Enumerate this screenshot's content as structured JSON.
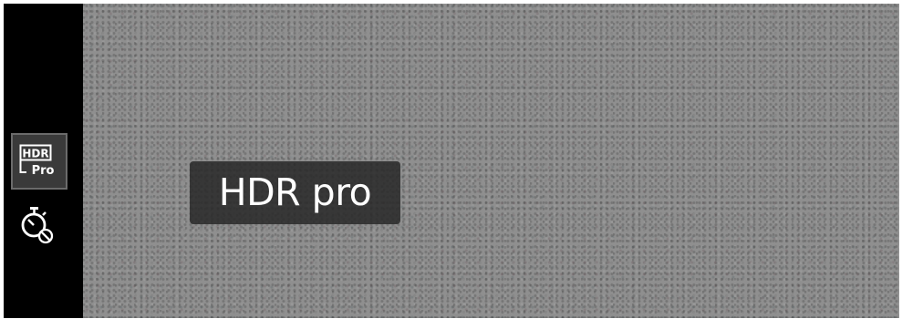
{
  "sidebar": {
    "hdr_button": {
      "icon": "hdr-pro-icon",
      "icon_line1": "HDR",
      "icon_line2": "Pro",
      "selected": true
    },
    "timer_button": {
      "icon": "self-timer-off-icon"
    }
  },
  "toast": {
    "text": "HDR pro"
  },
  "colors": {
    "sidebar_bg": "#000000",
    "selected_bg": "#3a3a3a",
    "selected_border": "#6b6b6b",
    "toast_bg": "#282828",
    "toast_text": "#ffffff",
    "viewfinder": "#8f8f8f"
  }
}
